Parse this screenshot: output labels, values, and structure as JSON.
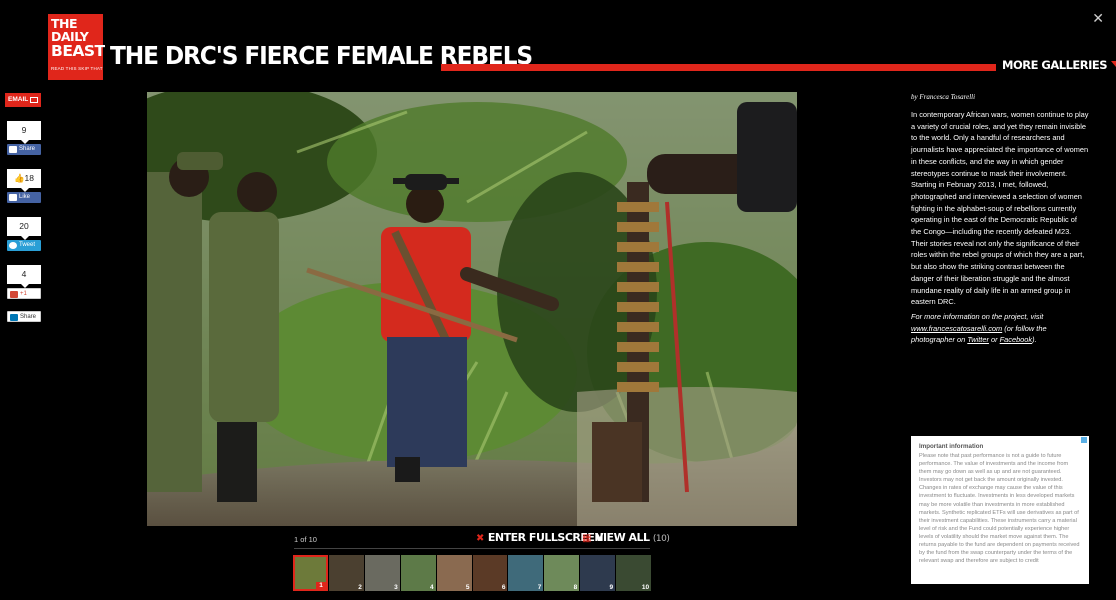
{
  "brand": {
    "line1": "THE DAILY",
    "line2": "BEAST",
    "tagline": "READ THIS SKIP THAT"
  },
  "page_title": "THE DRC'S FIERCE FEMALE REBELS",
  "more_galleries": "MORE GALLERIES",
  "close_glyph": "✕",
  "social": {
    "email": "EMAIL",
    "share_count": "9",
    "share_label": "Share",
    "like_count": "👍18",
    "like_label": "Like",
    "tweet_count": "20",
    "tweet_label": "Tweet",
    "gplus_count": "4",
    "gplus_label": "+1",
    "linkedin_label": "Share"
  },
  "byline": "by Francesca Tosarelli",
  "article": "In contemporary African wars, women continue to play a variety of crucial roles, and yet they remain invisible to the world. Only a handful of researchers and journalists have appreciated the importance of women in these conflicts, and the way in which gender stereotypes continue to mask their involvement. Starting in February 2013, I met, followed, photographed and interviewed a selection of women fighting in the alphabet-soup of rebellions currently operating in the east of the Democratic Republic of the Congo—including the recently defeated M23. Their stories reveal not only the significance of their roles within the rebel groups of which they are a part, but also show the striking contrast between the danger of their liberation struggle and the almost mundane reality of daily life in an armed group in eastern DRC.",
  "more_info": {
    "prefix": "For more information on the project, visit",
    "site": "www.francescatosarelli.com",
    "mid": "(or follow the photographer on",
    "twitter": "Twitter",
    "or": "or",
    "facebook": "Facebook",
    "end": ")."
  },
  "ad": {
    "title": "Important information",
    "body": "Please note that past performance is not a guide to future performance. The value of investments and the income from them may go down as well as up and are not guaranteed. Investors may not get back the amount originally invested. Changes in rates of exchange may cause the value of this investment to fluctuate. Investments in less developed markets may be more volatile than investments in more established markets. Synthetic replicated ETFs will use derivatives as part of their investment capabilities. These instruments carry a material level of risk and the Fund could potentially experience higher levels of volatility should the market move against them. The returns payable to the fund are dependent on payments received by the fund from the swap counterparty under the terms of the relevant swap and therefore are subject to credit"
  },
  "gallery": {
    "counter": "1 of 10",
    "fullscreen": "ENTER FULLSCREEN",
    "view_all": "VIEW ALL",
    "view_all_count": "(10)",
    "thumbs": [
      {
        "num": "1",
        "color": "#6d7a3a"
      },
      {
        "num": "2",
        "color": "#4b4030"
      },
      {
        "num": "3",
        "color": "#6a6a60"
      },
      {
        "num": "4",
        "color": "#5d7a48"
      },
      {
        "num": "5",
        "color": "#8a6a50"
      },
      {
        "num": "6",
        "color": "#5b3a26"
      },
      {
        "num": "7",
        "color": "#3f6a7a"
      },
      {
        "num": "8",
        "color": "#6e8a5a"
      },
      {
        "num": "9",
        "color": "#2e3a4e"
      },
      {
        "num": "10",
        "color": "#3a4a32"
      }
    ]
  },
  "colors": {
    "accent": "#e0261b",
    "background": "#000000"
  }
}
